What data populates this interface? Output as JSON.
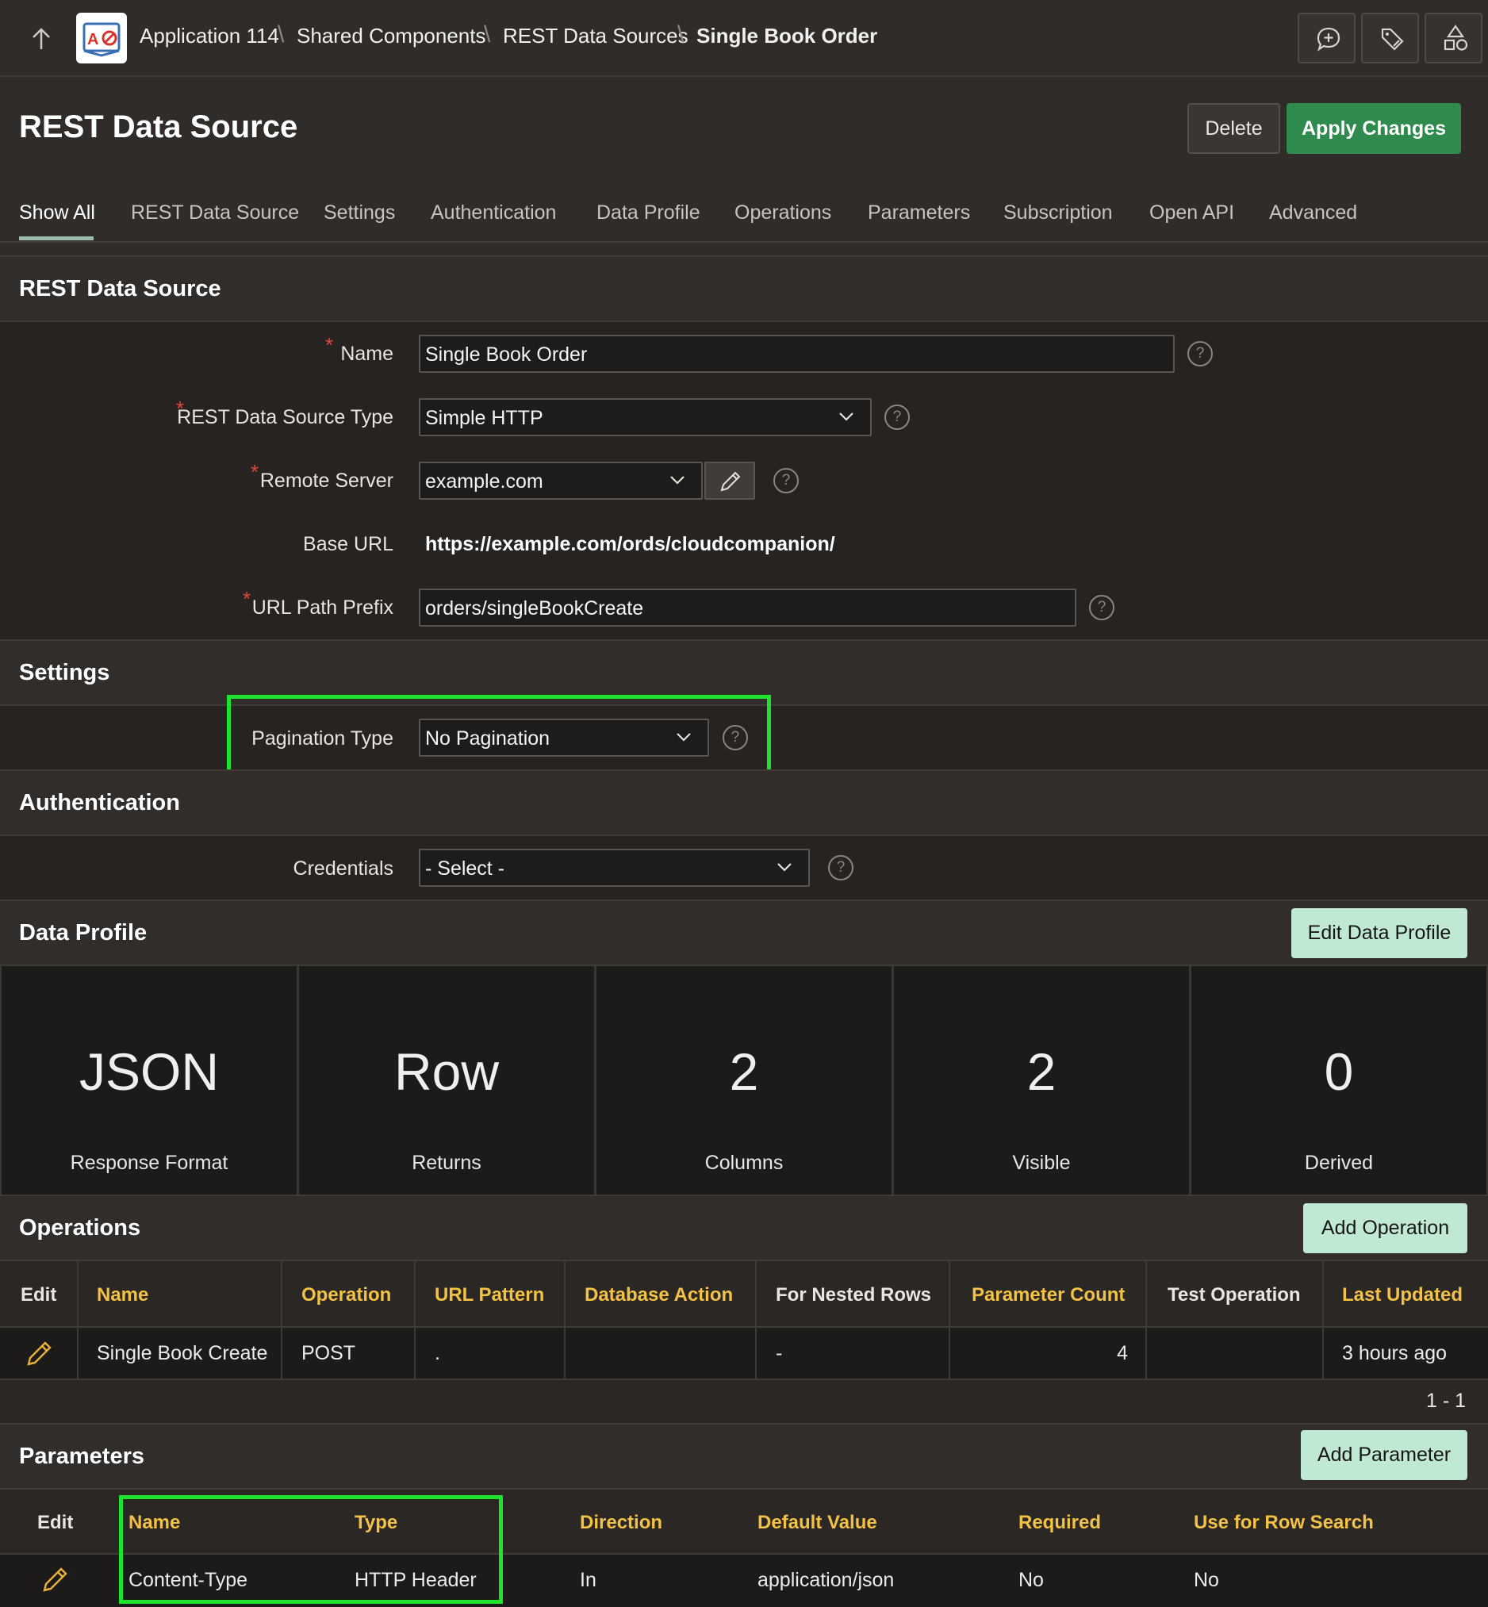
{
  "breadcrumb": {
    "items": [
      "Application 114",
      "Shared Components",
      "REST Data Sources"
    ],
    "current": "Single Book Order",
    "separator": "\\"
  },
  "page": {
    "title": "REST Data Source",
    "delete_label": "Delete",
    "apply_label": "Apply Changes"
  },
  "tabs": [
    "Show All",
    "REST Data Source",
    "Settings",
    "Authentication",
    "Data Profile",
    "Operations",
    "Parameters",
    "Subscription",
    "Open API",
    "Advanced"
  ],
  "rest_data_source": {
    "title": "REST Data Source",
    "name_label": "Name",
    "name_value": "Single Book Order",
    "type_label": "REST Data Source Type",
    "type_value": "Simple HTTP",
    "server_label": "Remote Server",
    "server_value": "example.com",
    "base_url_label": "Base URL",
    "base_url_value": "https://example.com/ords/cloudcompanion/",
    "prefix_label": "URL Path Prefix",
    "prefix_value": "orders/singleBookCreate",
    "required_mark": "*",
    "help_mark": "?"
  },
  "settings": {
    "title": "Settings",
    "pagination_label": "Pagination Type",
    "pagination_value": "No Pagination"
  },
  "authentication": {
    "title": "Authentication",
    "credentials_label": "Credentials",
    "credentials_value": "- Select -"
  },
  "data_profile": {
    "title": "Data Profile",
    "edit_label": "Edit Data Profile",
    "stats": [
      {
        "value": "JSON",
        "label": "Response Format"
      },
      {
        "value": "Row",
        "label": "Returns"
      },
      {
        "value": "2",
        "label": "Columns"
      },
      {
        "value": "2",
        "label": "Visible"
      },
      {
        "value": "0",
        "label": "Derived"
      }
    ]
  },
  "operations": {
    "title": "Operations",
    "add_label": "Add Operation",
    "columns": [
      "Edit",
      "Name",
      "Operation",
      "URL Pattern",
      "Database Action",
      "For Nested Rows",
      "Parameter Count",
      "Test Operation",
      "Last Updated"
    ],
    "rows": [
      {
        "name": "Single Book Create",
        "operation": "POST",
        "url_pattern": ".",
        "database_action": "",
        "for_nested_rows": "-",
        "parameter_count": "4",
        "test_operation": "",
        "last_updated": "3 hours ago"
      }
    ],
    "pagination": "1 - 1"
  },
  "parameters": {
    "title": "Parameters",
    "add_label": "Add Parameter",
    "columns": [
      "Edit",
      "Name",
      "Type",
      "Direction",
      "Default Value",
      "Required",
      "Use for Row Search"
    ],
    "rows": [
      {
        "name": "Content-Type",
        "type": "HTTP Header",
        "direction": "In",
        "default_value": "application/json",
        "required": "No",
        "use_for_row_search": "No"
      }
    ]
  },
  "colors": {
    "accent_green": "#2e8a4d",
    "mint_button": "#bfe9d2",
    "header_gold": "#f2c146",
    "highlight": "#1ee32e",
    "required_red": "#e0453a"
  }
}
